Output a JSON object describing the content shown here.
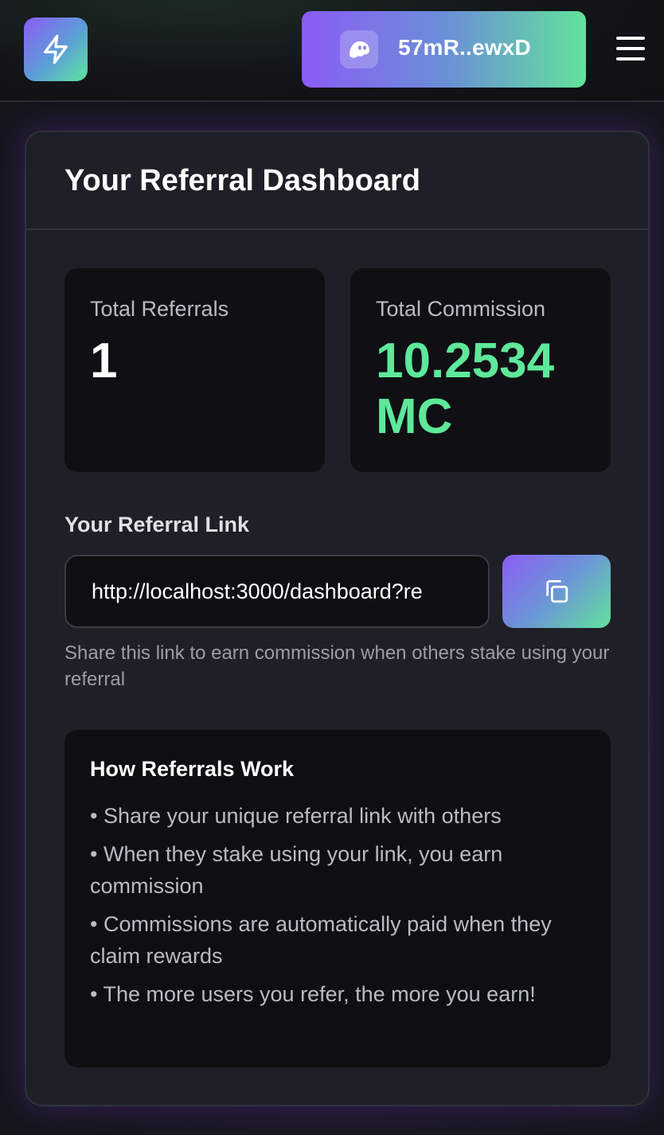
{
  "header": {
    "logo_icon": "lightning-bolt-icon",
    "wallet": {
      "icon": "phantom-ghost-icon",
      "address": "57mR..ewxD"
    },
    "menu_icon": "hamburger-menu-icon"
  },
  "dashboard": {
    "title": "Your Referral Dashboard",
    "stats": {
      "total_referrals_label": "Total Referrals",
      "total_referrals_value": "1",
      "total_commission_label": "Total Commission",
      "total_commission_value": "10.2534 MC"
    },
    "referral_link": {
      "label": "Your Referral Link",
      "value": "http://localhost:3000/dashboard?re",
      "copy_icon": "copy-icon",
      "hint": "Share this link to earn commission when others stake using your referral"
    },
    "how_it_works": {
      "title": "How Referrals Work",
      "items": [
        "• Share your unique referral link with others",
        "• When they stake using your link, you earn commission",
        "• Commissions are automatically paid when they claim rewards",
        "• The more users you refer, the more you earn!"
      ]
    }
  },
  "colors": {
    "accent_green": "#5ee89a",
    "accent_purple": "#8b5cf6",
    "card_bg": "#1e1f27"
  }
}
